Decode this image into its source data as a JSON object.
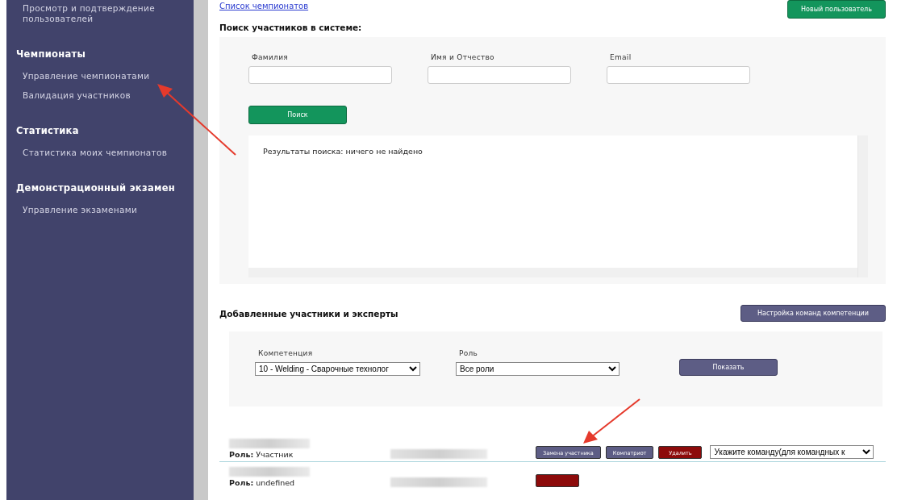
{
  "sidebar": {
    "items": [
      {
        "kind": "item",
        "label": "Просмотр и подтверждение пользователей"
      },
      {
        "kind": "header",
        "label": "Чемпионаты"
      },
      {
        "kind": "item",
        "label": "Управление чемпионатами"
      },
      {
        "kind": "item",
        "label": "Валидация участников"
      },
      {
        "kind": "header",
        "label": "Статистика"
      },
      {
        "kind": "item",
        "label": "Статистика моих чемпионатов"
      },
      {
        "kind": "header",
        "label": "Демонстрационный экзамен"
      },
      {
        "kind": "item",
        "label": "Управление экзаменами"
      }
    ]
  },
  "top": {
    "link": "Список чемпионатов",
    "new_user_button": "Новый пользователь"
  },
  "search": {
    "title": "Поиск участников в системе:",
    "fields": [
      {
        "label": "Фамилия"
      },
      {
        "label": "Имя и Отчество"
      },
      {
        "label": "Email"
      }
    ],
    "button": "Поиск",
    "results": "Результаты поиска: ничего не найдено"
  },
  "added": {
    "title": "Добавленные участники и эксперты",
    "settings_button": "Настройка команд компетенции",
    "filters": [
      {
        "label": "Компетенция",
        "value": "10 - Welding - Сварочные технолог"
      },
      {
        "label": "Роль",
        "value": "Все роли"
      }
    ],
    "show_button": "Показать"
  },
  "participants": [
    {
      "role_label": "Роль:",
      "role": "Участник",
      "buttons": [
        {
          "kind": "neutral",
          "label": "Замена участника"
        },
        {
          "kind": "neutral",
          "label": "Компатриот"
        },
        {
          "kind": "danger",
          "label": "Удалить"
        }
      ],
      "team_select": "Укажите команду(для командных к"
    },
    {
      "role_label": "Роль:",
      "role": "undefined",
      "buttons": [
        {
          "kind": "danger"
        }
      ]
    }
  ]
}
